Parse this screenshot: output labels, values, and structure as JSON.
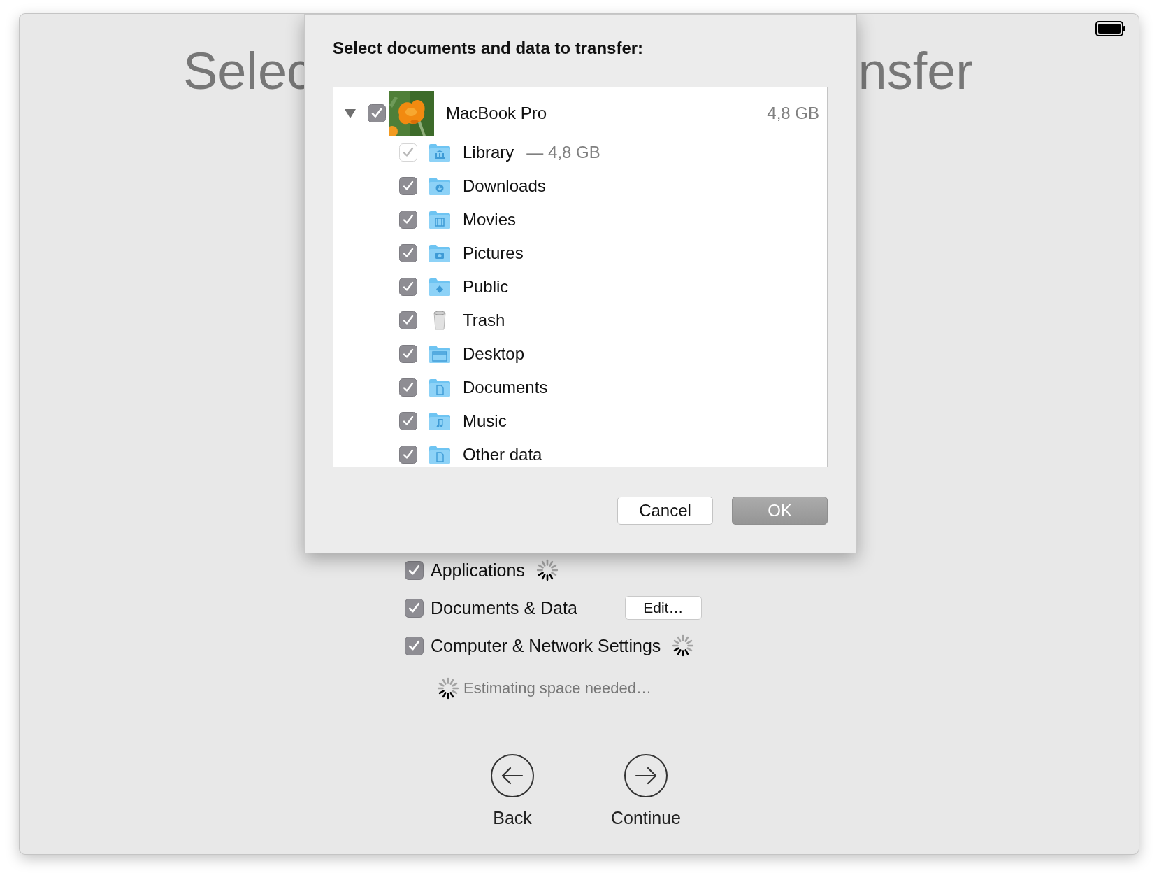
{
  "window": {
    "title_left": "Selec",
    "title_right": "nsfer"
  },
  "dialog": {
    "title": "Select documents and data to transfer:",
    "tree": [
      {
        "label": "MacBook Pro",
        "size": "4,8 GB",
        "checked": true,
        "expanded": true,
        "kind": "picture",
        "children": [
          {
            "label": "Library",
            "size": "— 4,8 GB",
            "checked": true,
            "disabled": true,
            "kind": "library"
          },
          {
            "label": "Downloads",
            "checked": true,
            "disabled": false,
            "kind": "downloads"
          },
          {
            "label": "Movies",
            "checked": true,
            "disabled": false,
            "kind": "movies"
          },
          {
            "label": "Pictures",
            "checked": true,
            "disabled": false,
            "kind": "pictures"
          },
          {
            "label": "Public",
            "checked": true,
            "disabled": false,
            "kind": "public"
          },
          {
            "label": "Trash",
            "checked": true,
            "disabled": false,
            "kind": "trash"
          },
          {
            "label": "Desktop",
            "checked": true,
            "disabled": false,
            "kind": "desktop"
          },
          {
            "label": "Documents",
            "checked": true,
            "disabled": false,
            "kind": "documents"
          },
          {
            "label": "Music",
            "checked": true,
            "disabled": false,
            "kind": "music"
          },
          {
            "label": "Other data",
            "checked": true,
            "disabled": false,
            "kind": "documents"
          }
        ]
      }
    ],
    "buttons": [
      {
        "label": "Cancel",
        "kind": "cancel"
      },
      {
        "label": "OK",
        "kind": "default"
      }
    ]
  },
  "options": [
    {
      "label": "Applications",
      "checked": true,
      "kind": "spinner"
    },
    {
      "label": "Documents & Data",
      "checked": true,
      "kind": "button",
      "button": "Edit…"
    },
    {
      "label": "Computer & Network Settings",
      "checked": true,
      "kind": "spinner"
    }
  ],
  "status": {
    "text": "Estimating space needed…"
  },
  "nav": [
    {
      "label": "Back",
      "kind": "back"
    },
    {
      "label": "Continue",
      "kind": "forward"
    }
  ]
}
